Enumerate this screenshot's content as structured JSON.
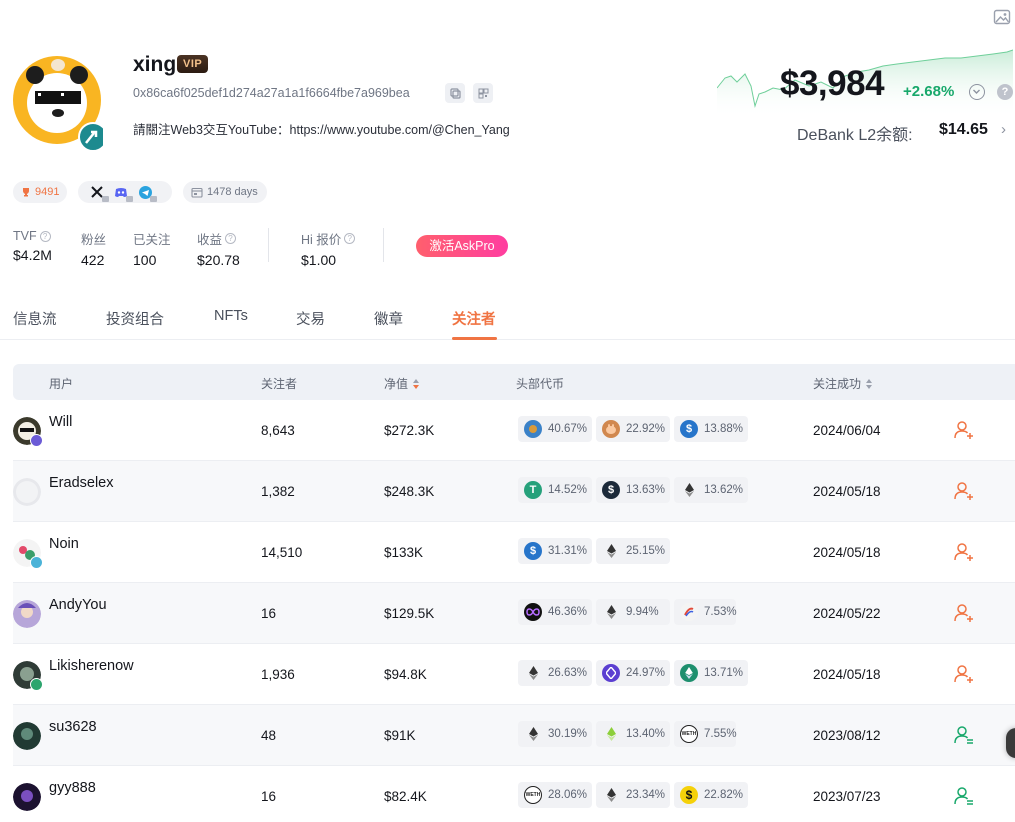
{
  "profile": {
    "name": "xing",
    "vip": "VIP",
    "address": "0x86ca6f025def1d274a27a1a1f6664fbe7a969bea",
    "bio": "請關注Web3交互YouTube：https://www.youtube.com/@Chen_Yang",
    "score": "9491",
    "days": "1478 days"
  },
  "balance": {
    "total": "$3,984",
    "change": "+2.68%",
    "l2_label": "DeBank L2余额:",
    "l2_value": "$14.65"
  },
  "stats": [
    {
      "label": "TVF",
      "value": "$4.2M"
    },
    {
      "label": "粉丝",
      "value": "422"
    },
    {
      "label": "已关注",
      "value": "100"
    },
    {
      "label": "收益",
      "value": "$20.78"
    },
    {
      "label": "Hi 报价",
      "value": "$1.00"
    }
  ],
  "askpro": "激活AskPro",
  "tabs": [
    "信息流",
    "投资组合",
    "NFTs",
    "交易",
    "徽章",
    "关注者"
  ],
  "table": {
    "headers": [
      "用户",
      "关注者",
      "净值",
      "头部代币",
      "关注成功"
    ],
    "rows": [
      {
        "name": "Will",
        "followers": "8,643",
        "net": "$272.3K",
        "tokens": [
          "40.67%",
          "22.92%",
          "13.88%"
        ],
        "date": "2024/06/04",
        "followed": false
      },
      {
        "name": "Eradselex",
        "followers": "1,382",
        "net": "$248.3K",
        "tokens": [
          "14.52%",
          "13.63%",
          "13.62%"
        ],
        "date": "2024/05/18",
        "followed": false
      },
      {
        "name": "Noin",
        "followers": "14,510",
        "net": "$133K",
        "tokens": [
          "31.31%",
          "25.15%"
        ],
        "date": "2024/05/18",
        "followed": false
      },
      {
        "name": "AndyYou",
        "followers": "16",
        "net": "$129.5K",
        "tokens": [
          "46.36%",
          "9.94%",
          "7.53%"
        ],
        "date": "2024/05/22",
        "followed": false
      },
      {
        "name": "Likisherenow",
        "followers": "1,936",
        "net": "$94.8K",
        "tokens": [
          "26.63%",
          "24.97%",
          "13.71%"
        ],
        "date": "2024/05/18",
        "followed": false
      },
      {
        "name": "su3628",
        "followers": "48",
        "net": "$91K",
        "tokens": [
          "30.19%",
          "13.40%",
          "7.55%"
        ],
        "date": "2023/08/12",
        "followed": true
      },
      {
        "name": "gyy888",
        "followers": "16",
        "net": "$82.4K",
        "tokens": [
          "28.06%",
          "23.34%",
          "22.82%"
        ],
        "date": "2023/07/23",
        "followed": true
      }
    ]
  },
  "colors": {
    "accent": "#f07443",
    "positive": "#18a86b",
    "follow": "#f07443",
    "followed": "#18a86b"
  }
}
